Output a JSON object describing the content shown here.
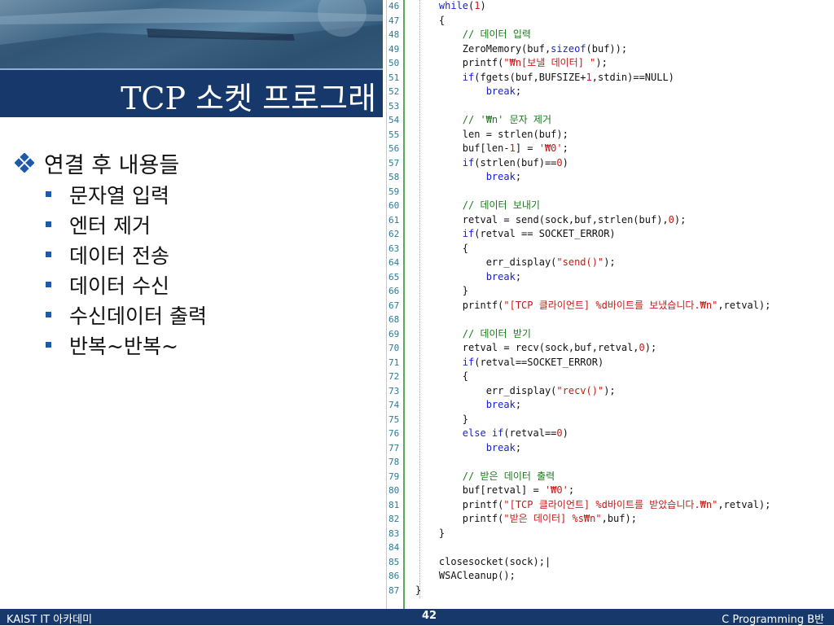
{
  "slide": {
    "title": "TCP 소켓 프로그래",
    "bullet_main": "연결 후 내용들",
    "sub_bullets": [
      "문자열 입력",
      "엔터 제거",
      "데이터 전송",
      "데이터 수신",
      "수신데이터 출력",
      "반복~반복~"
    ]
  },
  "code": {
    "lines": [
      {
        "n": "46",
        "t": [
          [
            "    ",
            "txt"
          ],
          [
            "while",
            "kw"
          ],
          [
            "(",
            "txt"
          ],
          [
            "1",
            "num"
          ],
          [
            ")",
            "txt"
          ]
        ]
      },
      {
        "n": "47",
        "t": [
          [
            "    {",
            "txt"
          ]
        ]
      },
      {
        "n": "48",
        "t": [
          [
            "        ",
            "txt"
          ],
          [
            "// 데이터 입력",
            "cm"
          ]
        ]
      },
      {
        "n": "49",
        "t": [
          [
            "        ZeroMemory(buf,",
            "txt"
          ],
          [
            "sizeof",
            "kw"
          ],
          [
            "(buf));",
            "txt"
          ]
        ]
      },
      {
        "n": "50",
        "t": [
          [
            "        printf(",
            "txt"
          ],
          [
            "\"₩n[보낼 데이터] \"",
            "str"
          ],
          [
            ");",
            "txt"
          ]
        ]
      },
      {
        "n": "51",
        "t": [
          [
            "        ",
            "txt"
          ],
          [
            "if",
            "kw"
          ],
          [
            "(fgets(buf,BUFSIZE+",
            "txt"
          ],
          [
            "1",
            "num"
          ],
          [
            ",stdin)==NULL)",
            "txt"
          ]
        ]
      },
      {
        "n": "52",
        "t": [
          [
            "            ",
            "txt"
          ],
          [
            "break",
            "kw"
          ],
          [
            ";",
            "txt"
          ]
        ]
      },
      {
        "n": "53",
        "t": [
          [
            "",
            "txt"
          ]
        ]
      },
      {
        "n": "54",
        "t": [
          [
            "        ",
            "txt"
          ],
          [
            "// '₩n' 문자 제거",
            "cm"
          ]
        ]
      },
      {
        "n": "55",
        "t": [
          [
            "        len = strlen(buf);",
            "txt"
          ]
        ]
      },
      {
        "n": "56",
        "t": [
          [
            "        buf[len-",
            "txt"
          ],
          [
            "1",
            "num"
          ],
          [
            "] = ",
            "txt"
          ],
          [
            "'₩0'",
            "str"
          ],
          [
            ";",
            "txt"
          ]
        ]
      },
      {
        "n": "57",
        "t": [
          [
            "        ",
            "txt"
          ],
          [
            "if",
            "kw"
          ],
          [
            "(strlen(buf)==",
            "txt"
          ],
          [
            "0",
            "num"
          ],
          [
            ")",
            "txt"
          ]
        ]
      },
      {
        "n": "58",
        "t": [
          [
            "            ",
            "txt"
          ],
          [
            "break",
            "kw"
          ],
          [
            ";",
            "txt"
          ]
        ]
      },
      {
        "n": "59",
        "t": [
          [
            "",
            "txt"
          ]
        ]
      },
      {
        "n": "60",
        "t": [
          [
            "        ",
            "txt"
          ],
          [
            "// 데이터 보내기",
            "cm"
          ]
        ]
      },
      {
        "n": "61",
        "t": [
          [
            "        retval = send(sock,buf,strlen(buf),",
            "txt"
          ],
          [
            "0",
            "num"
          ],
          [
            ");",
            "txt"
          ]
        ]
      },
      {
        "n": "62",
        "t": [
          [
            "        ",
            "txt"
          ],
          [
            "if",
            "kw"
          ],
          [
            "(retval == SOCKET_ERROR)",
            "txt"
          ]
        ]
      },
      {
        "n": "63",
        "t": [
          [
            "        {",
            "txt"
          ]
        ]
      },
      {
        "n": "64",
        "t": [
          [
            "            err_display(",
            "txt"
          ],
          [
            "\"send()\"",
            "str"
          ],
          [
            ");",
            "txt"
          ]
        ]
      },
      {
        "n": "65",
        "t": [
          [
            "            ",
            "txt"
          ],
          [
            "break",
            "kw"
          ],
          [
            ";",
            "txt"
          ]
        ]
      },
      {
        "n": "66",
        "t": [
          [
            "        }",
            "txt"
          ]
        ]
      },
      {
        "n": "67",
        "t": [
          [
            "        printf(",
            "txt"
          ],
          [
            "\"[TCP 클라이언트] %d바이트를 보냈습니다.₩n\"",
            "str"
          ],
          [
            ",retval);",
            "txt"
          ]
        ]
      },
      {
        "n": "68",
        "t": [
          [
            "",
            "txt"
          ]
        ]
      },
      {
        "n": "69",
        "t": [
          [
            "        ",
            "txt"
          ],
          [
            "// 데이터 받기",
            "cm"
          ]
        ]
      },
      {
        "n": "70",
        "t": [
          [
            "        retval = recv(sock,buf,retval,",
            "txt"
          ],
          [
            "0",
            "num"
          ],
          [
            ");",
            "txt"
          ]
        ]
      },
      {
        "n": "71",
        "t": [
          [
            "        ",
            "txt"
          ],
          [
            "if",
            "kw"
          ],
          [
            "(retval==SOCKET_ERROR)",
            "txt"
          ]
        ]
      },
      {
        "n": "72",
        "t": [
          [
            "        {",
            "txt"
          ]
        ]
      },
      {
        "n": "73",
        "t": [
          [
            "            err_display(",
            "txt"
          ],
          [
            "\"recv()\"",
            "str"
          ],
          [
            ");",
            "txt"
          ]
        ]
      },
      {
        "n": "74",
        "t": [
          [
            "            ",
            "txt"
          ],
          [
            "break",
            "kw"
          ],
          [
            ";",
            "txt"
          ]
        ]
      },
      {
        "n": "75",
        "t": [
          [
            "        }",
            "txt"
          ]
        ]
      },
      {
        "n": "76",
        "t": [
          [
            "        ",
            "txt"
          ],
          [
            "else if",
            "kw"
          ],
          [
            "(retval==",
            "txt"
          ],
          [
            "0",
            "num"
          ],
          [
            ")",
            "txt"
          ]
        ]
      },
      {
        "n": "77",
        "t": [
          [
            "            ",
            "txt"
          ],
          [
            "break",
            "kw"
          ],
          [
            ";",
            "txt"
          ]
        ]
      },
      {
        "n": "78",
        "t": [
          [
            "",
            "txt"
          ]
        ]
      },
      {
        "n": "79",
        "t": [
          [
            "        ",
            "txt"
          ],
          [
            "// 받은 데이터 출력",
            "cm"
          ]
        ]
      },
      {
        "n": "80",
        "t": [
          [
            "        buf[retval] = ",
            "txt"
          ],
          [
            "'₩0'",
            "str"
          ],
          [
            ";",
            "txt"
          ]
        ]
      },
      {
        "n": "81",
        "t": [
          [
            "        printf(",
            "txt"
          ],
          [
            "\"[TCP 클라이언트] %d바이트를 받았습니다.₩n\"",
            "str"
          ],
          [
            ",retval);",
            "txt"
          ]
        ]
      },
      {
        "n": "82",
        "t": [
          [
            "        printf(",
            "txt"
          ],
          [
            "\"받은 데이터] %s₩n\"",
            "str"
          ],
          [
            ",buf);",
            "txt"
          ]
        ]
      },
      {
        "n": "83",
        "t": [
          [
            "    }",
            "txt"
          ]
        ]
      },
      {
        "n": "84",
        "t": [
          [
            "",
            "txt"
          ]
        ]
      },
      {
        "n": "85",
        "t": [
          [
            "    closesocket(sock);|",
            "txt"
          ]
        ]
      },
      {
        "n": "86",
        "t": [
          [
            "    WSACleanup();",
            "txt"
          ]
        ]
      },
      {
        "n": "87",
        "t": [
          [
            "}",
            "txt"
          ]
        ]
      }
    ]
  },
  "footer": {
    "left": "KAIST IT 아카데미",
    "page": "42",
    "right": "C Programming B반"
  },
  "colors": {
    "title_bar": "#17386a",
    "footer_bar": "#17386a",
    "bullet_square": "#1f5aa8",
    "code_keyword": "#1a22d0",
    "code_string": "#c41a16",
    "code_comment": "#1a7a1a",
    "gutter_rule": "#5aaa5a"
  }
}
